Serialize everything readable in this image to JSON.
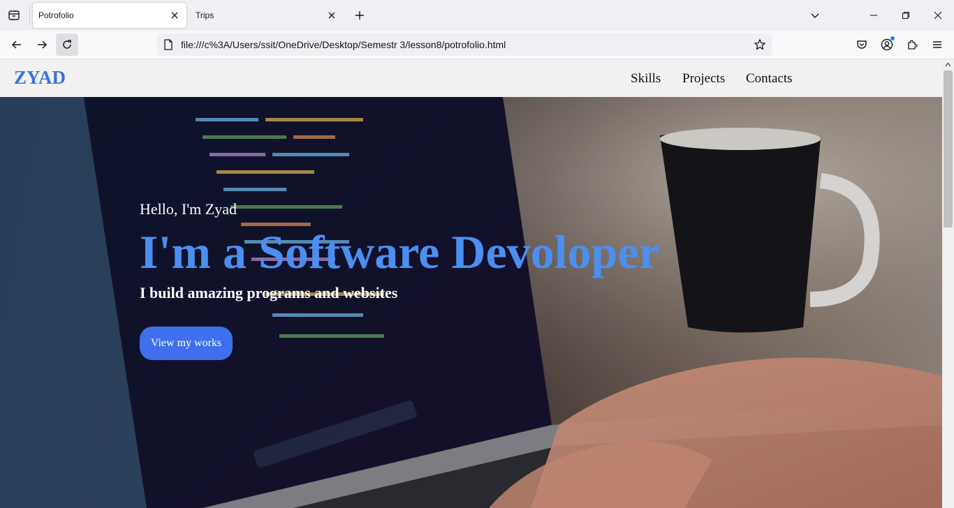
{
  "browser": {
    "tabs": [
      {
        "title": "Potrofolio",
        "active": true
      },
      {
        "title": "Trips",
        "active": false
      }
    ],
    "url": "file:///c%3A/Users/ssit/OneDrive/Desktop/Semestr 3/lesson8/potrofolio.html",
    "icons": [
      "tab-list-icon",
      "close-icon",
      "plus-icon",
      "chevron-down-icon",
      "minimize-icon",
      "restore-icon",
      "window-close-icon",
      "back-arrow-icon",
      "forward-arrow-icon",
      "reload-icon",
      "page-icon",
      "star-icon",
      "pocket-icon",
      "account-icon",
      "extensions-icon",
      "menu-icon"
    ],
    "accent": "#0a84ff"
  },
  "site": {
    "logo": "ZYAD",
    "nav": [
      "Skills",
      "Projects",
      "Contacts"
    ],
    "hero": {
      "greeting": "Hello, I'm Zyad",
      "headline": "I'm a Software Devoloper",
      "subline": "I build amazing programs and websites",
      "cta_label": "View my works"
    },
    "colors": {
      "logo": "#3a71e0",
      "headline": "#4b8ff0",
      "cta_bg": "#3f6fec",
      "header_bg": "#f1f1f1"
    }
  }
}
